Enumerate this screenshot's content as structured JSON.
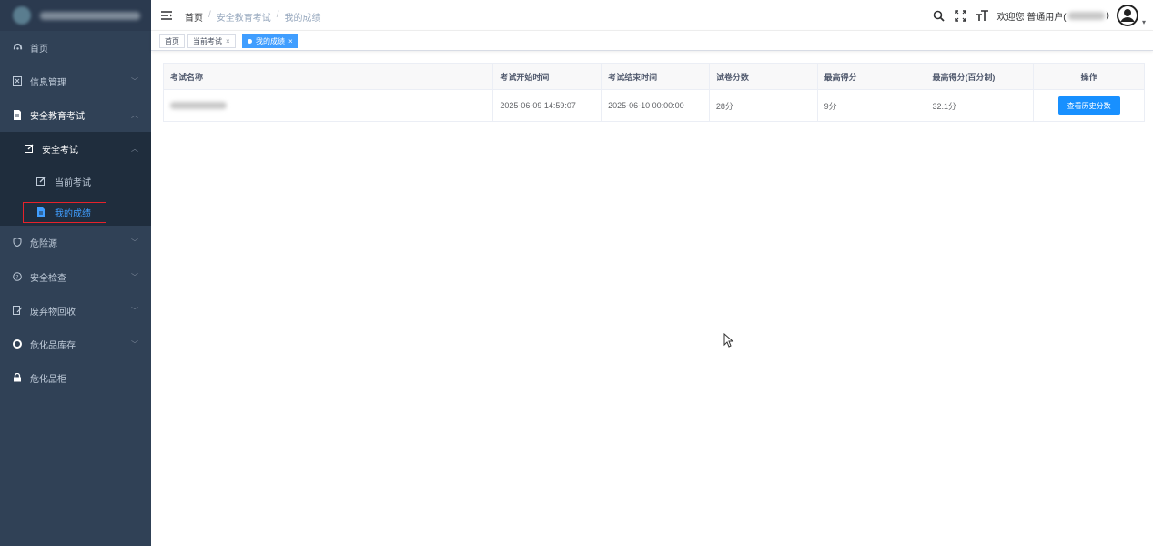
{
  "sidebar": {
    "items": [
      {
        "label": "首页",
        "icon": "dashboard-icon"
      },
      {
        "label": "信息管理",
        "icon": "info-icon"
      },
      {
        "label": "安全教育考试",
        "icon": "document-icon"
      },
      {
        "label": "安全考试",
        "icon": "edit-icon"
      },
      {
        "label": "当前考试",
        "icon": "edit-icon"
      },
      {
        "label": "我的成绩",
        "icon": "document-icon"
      },
      {
        "label": "危险源",
        "icon": "shield-icon"
      },
      {
        "label": "安全检查",
        "icon": "question-icon"
      },
      {
        "label": "废弃物回收",
        "icon": "recycle-icon"
      },
      {
        "label": "危化品库存",
        "icon": "lifebuoy-icon"
      },
      {
        "label": "危化品柜",
        "icon": "lock-icon"
      }
    ]
  },
  "header": {
    "breadcrumb": [
      "首页",
      "安全教育考试",
      "我的成绩"
    ],
    "breadcrumb_sep": "/",
    "welcome_prefix": "欢迎您 普通用户(",
    "welcome_suffix": ")"
  },
  "tags": [
    {
      "label": "首页"
    },
    {
      "label": "当前考试",
      "close": "×"
    },
    {
      "label": "我的成绩",
      "close": "×"
    }
  ],
  "table": {
    "columns": [
      "考试名称",
      "考试开始时间",
      "考试结束时间",
      "试卷分数",
      "最高得分",
      "最高得分(百分制)",
      "操作"
    ],
    "rows": [
      {
        "start": "2025-06-09 14:59:07",
        "end": "2025-06-10 00:00:00",
        "paper_score": "28分",
        "max_score": "9分",
        "max_percent": "32.1分",
        "action": "查看历史分数"
      }
    ]
  },
  "colors": {
    "sidebar_bg": "#304156",
    "accent": "#409eff",
    "button": "#1890ff",
    "highlight_box": "#e6222b"
  }
}
